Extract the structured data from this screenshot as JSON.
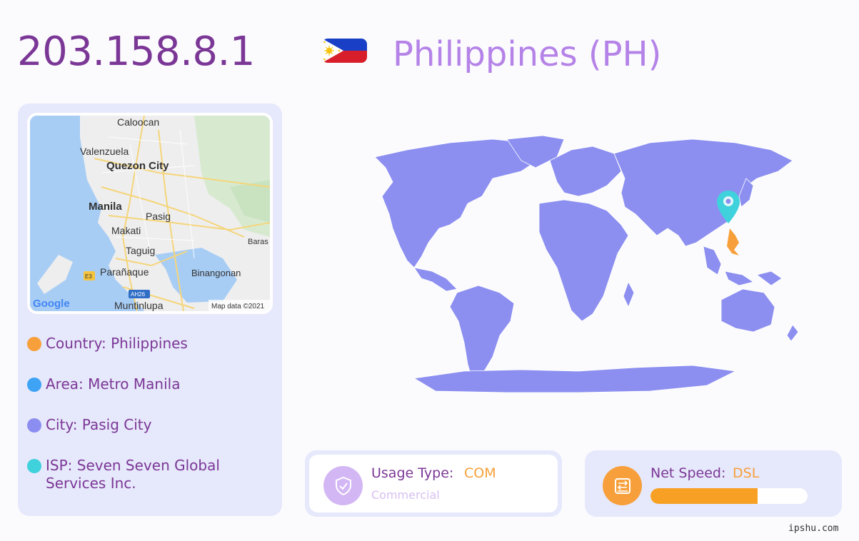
{
  "header": {
    "ip": "203.158.8.1",
    "country_title": "Philippines (PH)"
  },
  "minimap": {
    "labels": [
      "Caloocan",
      "Valenzuela",
      "Quezon City",
      "Manila",
      "Pasig",
      "Makati",
      "Taguig",
      "Baras",
      "Parañaque",
      "Binangonan",
      "Muntinlupa"
    ],
    "road_badges": [
      "E3",
      "AH26"
    ],
    "brand": "Google",
    "attribution": "Map data ©2021"
  },
  "info": {
    "items": [
      {
        "label": "Country: Philippines",
        "color": "#f7a03b"
      },
      {
        "label": "Area: Metro Manila",
        "color": "#3ea2f5"
      },
      {
        "label": "City: Pasig City",
        "color": "#8b8ef0"
      },
      {
        "label": "ISP: Seven Seven Global Services Inc.",
        "color": "#3fd1dc"
      }
    ]
  },
  "usage": {
    "label": "Usage Type:",
    "value": "COM",
    "sub": "Commercial",
    "icon": "shield-check-icon"
  },
  "speed": {
    "label": "Net Speed:",
    "value": "DSL",
    "icon": "router-icon",
    "level_percent": 68
  },
  "colors": {
    "land": "#8c8ff0",
    "highlight": "#f7a03b",
    "pin": "#3fd1dc",
    "accent_purple": "#7b3796"
  },
  "watermark": "ipshu.com"
}
